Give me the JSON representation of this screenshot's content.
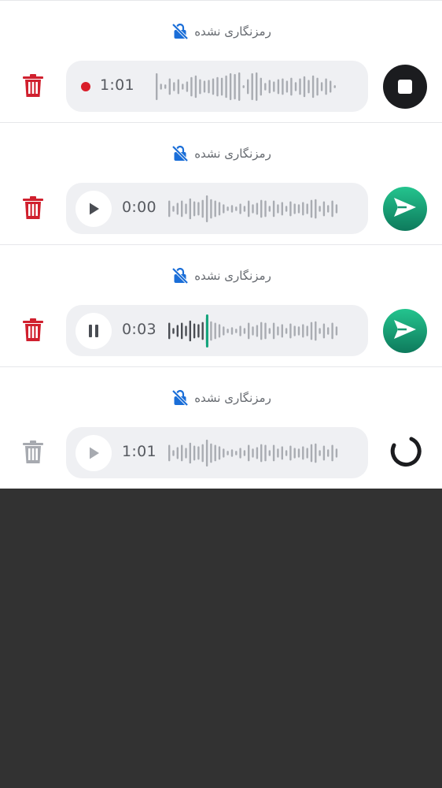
{
  "recordings": [
    {
      "encryption_label": "رمزنگاری نشده",
      "state": "recording",
      "time": "1:01",
      "action": "stop",
      "progress": 0,
      "trash_color": "#d0202e"
    },
    {
      "encryption_label": "رمزنگاری نشده",
      "state": "idle",
      "time": "0:00",
      "action": "send",
      "progress": 0,
      "trash_color": "#d0202e"
    },
    {
      "encryption_label": "رمزنگاری نشده",
      "state": "playing",
      "time": "0:03",
      "action": "send",
      "progress": 0.22,
      "trash_color": "#d0202e"
    },
    {
      "encryption_label": "رمزنگاری نشده",
      "state": "disabled",
      "time": "1:01",
      "action": "loading",
      "progress": 0,
      "trash_color": "#a7aab0"
    }
  ],
  "icons": {
    "delete": "trash-icon",
    "encryption": "lock-off-icon",
    "play": "play-icon",
    "pause": "pause-icon",
    "stop": "stop-icon",
    "send": "send-icon",
    "loading": "spinner-icon"
  },
  "colors": {
    "lock_icon": "#1a6ed8",
    "waveform": "#a9acb2",
    "waveform_played": "#4a4d53",
    "playhead": "#10a37a",
    "record_dot": "#d91e2a",
    "send_gradient": [
      "#24c48e",
      "#0e7a5c"
    ],
    "overlay": "#323232"
  }
}
